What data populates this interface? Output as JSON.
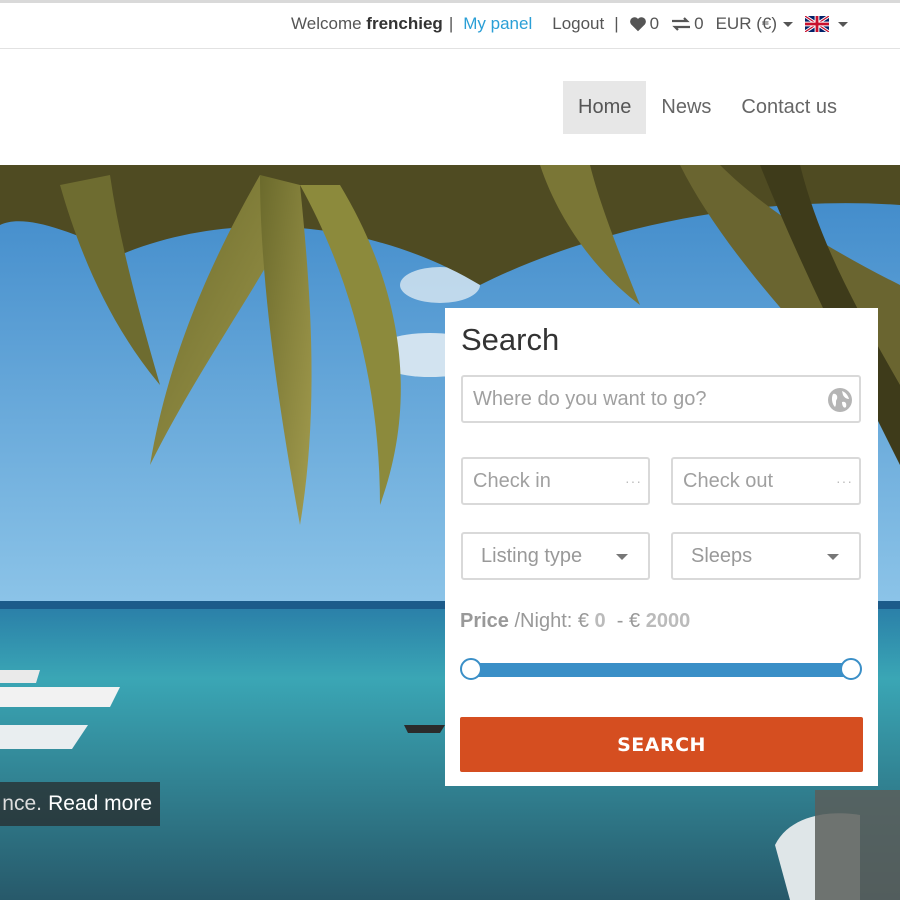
{
  "topbar": {
    "welcome_prefix": "Welcome",
    "username": "frenchieg",
    "separator": "|",
    "my_panel": "My panel",
    "logout": "Logout",
    "favorites_count": "0",
    "compare_count": "0",
    "currency": "EUR (€)",
    "language_icon": "uk-flag-icon"
  },
  "nav": {
    "items": [
      {
        "label": "Home",
        "active": true
      },
      {
        "label": "News",
        "active": false
      },
      {
        "label": "Contact us",
        "active": false
      }
    ]
  },
  "hero": {
    "caption_text": "nce.",
    "read_more": "Read more"
  },
  "search": {
    "title": "Search",
    "where_placeholder": "Where do you want to go?",
    "checkin_placeholder": "Check in",
    "checkout_placeholder": "Check out",
    "listing_type": "Listing type",
    "sleeps": "Sleeps",
    "price_label": "Price",
    "price_unit": "/Night: €",
    "price_min": "0",
    "price_dash": "- €",
    "price_max": "2000",
    "range_min_fraction": 0,
    "range_max_fraction": 1,
    "button_label": "SEARCH",
    "accent_color": "#d54e20",
    "slider_color": "#3a8fc7"
  }
}
